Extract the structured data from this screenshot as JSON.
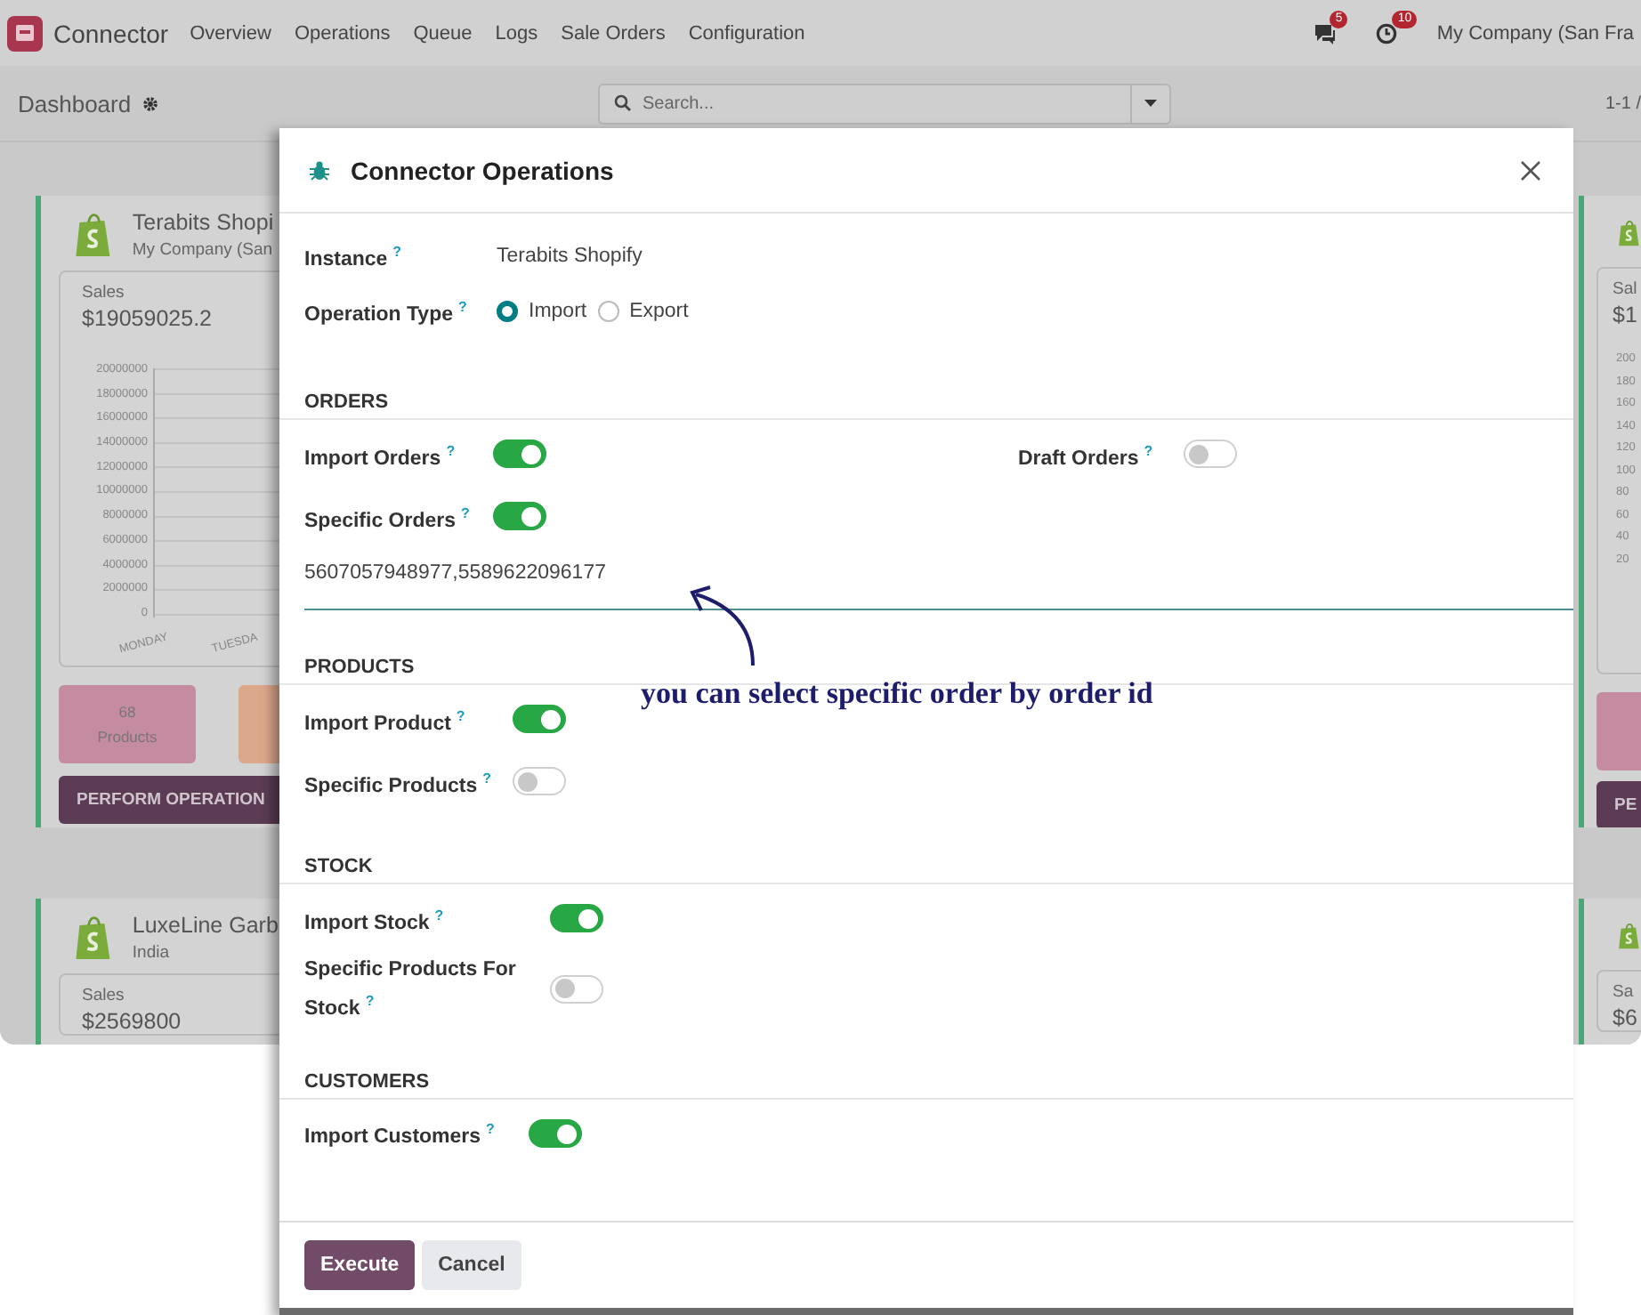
{
  "navbar": {
    "app_name": "Connector",
    "menu": [
      "Overview",
      "Operations",
      "Queue",
      "Logs",
      "Sale Orders",
      "Configuration"
    ],
    "messages_badge": "5",
    "activities_badge": "10",
    "company": "My Company (San Fra"
  },
  "control_panel": {
    "title": "Dashboard",
    "search": {
      "placeholder": "Search..."
    },
    "pager": "1-1 /"
  },
  "dashboard": {
    "left_cards": [
      {
        "name": "Terabits Shopi",
        "company": "My Company (San",
        "sales_label": "Sales",
        "sales_value": "$19059025.2",
        "chart_yticks": [
          "20000000",
          "18000000",
          "16000000",
          "14000000",
          "12000000",
          "10000000",
          "8000000",
          "6000000",
          "4000000",
          "2000000",
          "0"
        ],
        "chart_xlabels": [
          "MONDAY",
          "TUESDA"
        ],
        "stats": [
          {
            "value": "68",
            "label": "Products",
            "color": "#c58ba0"
          },
          {
            "color": "#dca88c"
          }
        ],
        "button": "PERFORM OPERATION"
      },
      {
        "name": "LuxeLine Garb",
        "company": "India",
        "sales_label": "Sales",
        "sales_value": "$2569800"
      }
    ],
    "right_cards": [
      {
        "sales_label": "Sal",
        "sales_value": "$1",
        "chart_yticks": [
          "200",
          "180",
          "160",
          "140",
          "120",
          "100",
          "80",
          "60",
          "40",
          "20"
        ],
        "button": "PE"
      },
      {
        "sales_label": "Sa",
        "sales_value": "$6"
      }
    ]
  },
  "dialog": {
    "title": "Connector Operations",
    "fields": [
      {
        "label": "Instance",
        "help": "?",
        "kind": "text",
        "value": "Terabits Shopify"
      },
      {
        "label": "Operation Type",
        "help": "?",
        "kind": "radio",
        "options": [
          {
            "label": "Import",
            "selected": true
          },
          {
            "label": "Export",
            "selected": false
          }
        ]
      }
    ],
    "sections": [
      {
        "title": "ORDERS",
        "rows": [
          [
            {
              "label": "Import Orders",
              "help": "?",
              "kind": "toggle",
              "on": true
            },
            {
              "label": "Draft Orders",
              "help": "?",
              "kind": "toggle",
              "on": false
            }
          ],
          [
            {
              "label": "Specific Orders",
              "help": "?",
              "kind": "toggle",
              "on": true
            }
          ],
          [
            {
              "kind": "input",
              "value": "5607057948977,5589622096177"
            }
          ]
        ]
      },
      {
        "title": "PRODUCTS",
        "rows": [
          [
            {
              "label": "Import Product",
              "help": "?",
              "kind": "toggle",
              "on": true
            }
          ],
          [
            {
              "label": "Specific Products",
              "help": "?",
              "kind": "toggle",
              "on": false
            }
          ]
        ]
      },
      {
        "title": "STOCK",
        "rows": [
          [
            {
              "label": "Import Stock",
              "help": "?",
              "kind": "toggle",
              "on": true
            }
          ],
          [
            {
              "label": "Specific Products For Stock",
              "help": "?",
              "kind": "toggle",
              "on": false
            }
          ]
        ]
      },
      {
        "title": "CUSTOMERS",
        "rows": [
          [
            {
              "label": "Import Customers",
              "help": "?",
              "kind": "toggle",
              "on": true
            }
          ]
        ]
      }
    ],
    "buttons": [
      {
        "label": "Execute",
        "kind": "primary"
      },
      {
        "label": "Cancel",
        "kind": "secondary"
      }
    ]
  },
  "annotation": {
    "text": "you can select specific order by order id"
  }
}
